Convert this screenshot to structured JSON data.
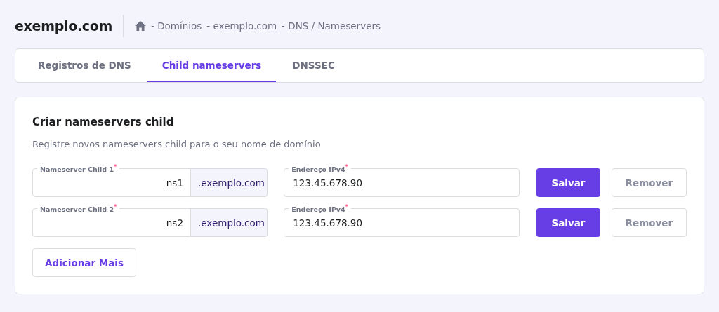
{
  "header": {
    "title": "exemplo.com",
    "breadcrumb": [
      "- Domínios",
      "- exemplo.com",
      "- DNS / Nameservers"
    ]
  },
  "tabs": [
    {
      "label": "Registros de DNS",
      "selected": false
    },
    {
      "label": "Child nameservers",
      "selected": true
    },
    {
      "label": "DNSSEC",
      "selected": false
    }
  ],
  "card": {
    "title": "Criar nameservers child",
    "description": "Registre novos nameservers child para o seu nome de domínio",
    "rows": [
      {
        "name_label": "Nameserver Child 1$^{*}$",
        "name_value": "ns1",
        "suffix": ".exemplo.com",
        "ip_label": "Endereço IPv4$^{*}$",
        "ip_value": "123.45.678.90",
        "save": "Salvar",
        "remove": "Remover"
      },
      {
        "name_label": "Nameserver Child 2$^{*}$",
        "name_value": "ns2",
        "suffix": ".exemplo.com",
        "ip_label": "Endereço IPv4$^{*}$",
        "ip_value": "123.45.678.90",
        "save": "Salvar",
        "remove": "Remover"
      }
    ],
    "add_button": "Adicionar Mais"
  }
}
